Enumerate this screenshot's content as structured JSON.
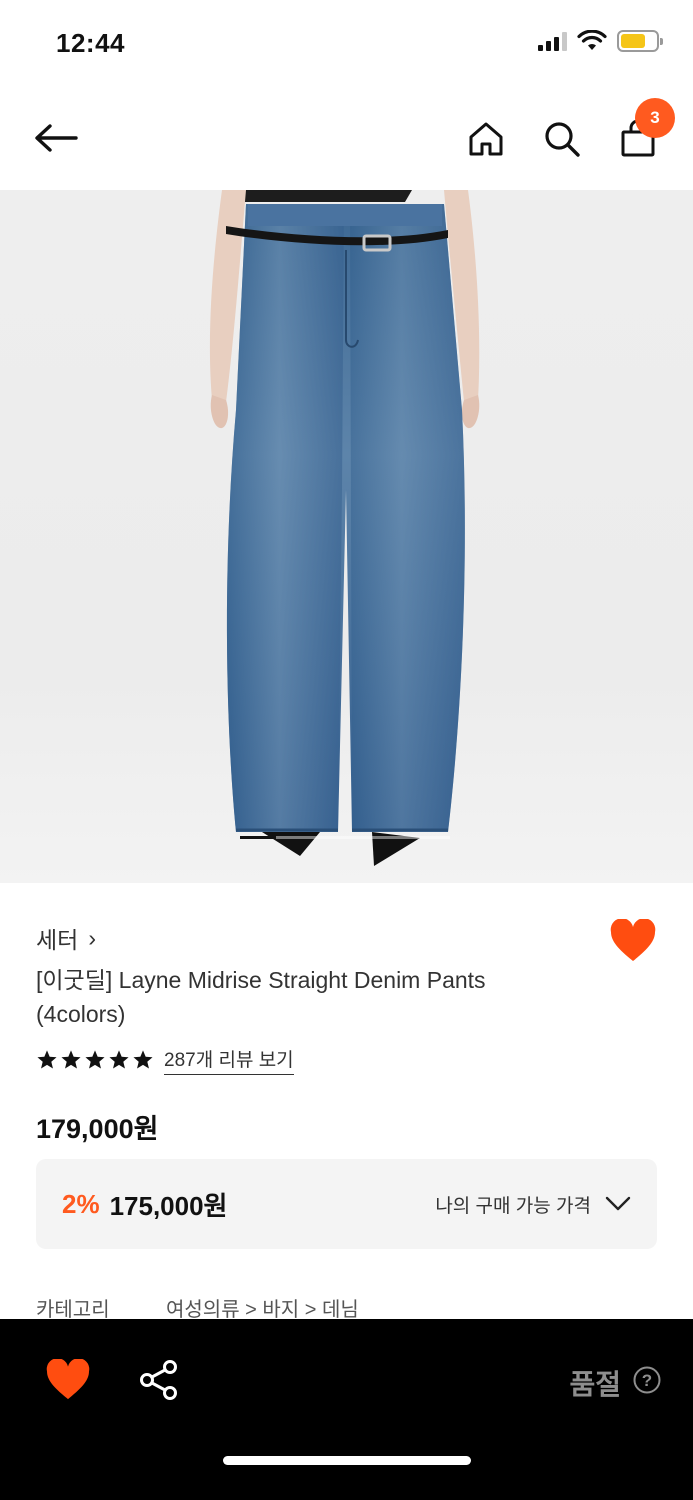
{
  "status_bar": {
    "time": "12:44"
  },
  "nav": {
    "cart_count": "3"
  },
  "product": {
    "brand": "세터",
    "brand_chevron": "›",
    "title": "[이굿딜] Layne Midrise Straight Denim Pants (4colors)",
    "rating_stars": 5,
    "review_link": "287개 리뷰 보기",
    "price": "179,000원",
    "my_price": {
      "discount_rate": "2%",
      "discounted_price": "175,000원",
      "label": "나의 구매 가능 가격"
    },
    "category": {
      "label": "카테고리",
      "path": "여성의류 > 바지 > 데님"
    },
    "image": {
      "current_index": 1
    }
  },
  "bottom_bar": {
    "soldout_label": "품절",
    "help_symbol": "?"
  },
  "colors": {
    "accent": "#ff5a1f",
    "denim": "#3f6a95",
    "bottom_bar": "#000000",
    "soldout_text": "#8e8e8e"
  },
  "icons": [
    "back-arrow-icon",
    "home-icon",
    "search-icon",
    "cart-icon",
    "heart-icon",
    "share-icon",
    "help-icon",
    "star-icon",
    "chevron-down-icon"
  ]
}
